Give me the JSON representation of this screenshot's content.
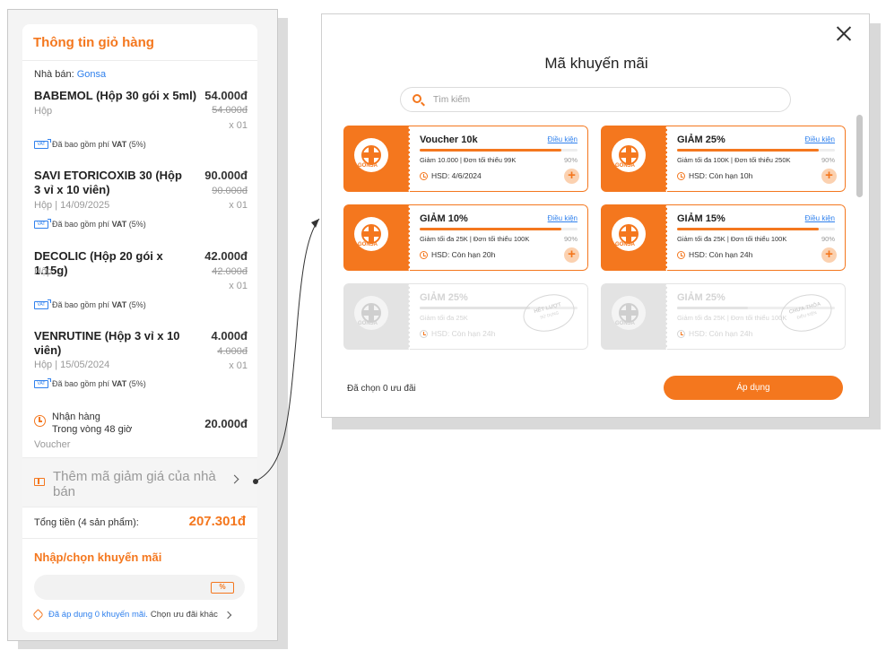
{
  "cart": {
    "title": "Thông tin giỏ hàng",
    "seller_label": "Nhà bán:",
    "seller_name": "Gonsa",
    "items": [
      {
        "name": "BABEMOL (Hộp 30 gói x 5ml)",
        "price": "54.000đ",
        "old_price": "54.000đ",
        "sub": "Hộp",
        "qty": "x 01",
        "vat_prefix": "Đã bao gồm phí",
        "vat_bold": "VAT",
        "vat_suffix": "(5%)"
      },
      {
        "name": "SAVI ETORICOXIB 30 (Hộp 3 vỉ x 10 viên)",
        "price": "90.000đ",
        "old_price": "90.000đ",
        "sub": "Hộp | 14/09/2025",
        "qty": "x 01",
        "vat_prefix": "Đã bao gồm phí",
        "vat_bold": "VAT",
        "vat_suffix": "(5%)"
      },
      {
        "name": "DECOLIC (Hộp 20 gói x 1.15g)",
        "price": "42.000đ",
        "old_price": "42.000đ",
        "sub": "Hộp",
        "qty": "x 01",
        "vat_prefix": "Đã bao gồm phí",
        "vat_bold": "VAT",
        "vat_suffix": "(5%)"
      },
      {
        "name": "VENRUTINE (Hộp 3 vỉ x 10 viên)",
        "price": "4.000đ",
        "old_price": "4.000đ",
        "sub": "Hộp | 15/05/2024",
        "qty": "x 01",
        "vat_prefix": "Đã bao gồm phí",
        "vat_bold": "VAT",
        "vat_suffix": "(5%)"
      }
    ],
    "vat_icon_text": "VAT",
    "delivery": {
      "line1": "Nhận hàng",
      "line2": "Trong vòng 48 giờ",
      "price": "20.000đ",
      "voucher_label": "Voucher"
    },
    "seller_discount": "Thêm mã giảm giá của nhà bán",
    "total_label": "Tổng tiền (4 sản phẩm):",
    "total_value": "207.301đ",
    "promo_title": "Nhập/chọn khuyến mãi",
    "promo_icon_text": "%",
    "applied_text": "Đã áp dụng 0 khuyến mãi.",
    "applied_other": "Chọn ưu đãi khác"
  },
  "modal": {
    "title": "Mã khuyến mãi",
    "search_placeholder": "Tìm kiếm",
    "brand": "GONSA",
    "condition_label": "Điều kiện",
    "vouchers": [
      {
        "title": "Voucher 10k",
        "desc": "Giảm 10.000 | Đơn tối thiểu 99K",
        "percent": "90%",
        "fill": 0.9,
        "expiry": "HSD: 4/6/2024",
        "state": "active"
      },
      {
        "title": "GIẢM 25%",
        "desc": "Giảm tối đa 100K | Đơn tối thiểu 250K",
        "percent": "90%",
        "fill": 0.9,
        "expiry": "HSD: Còn hạn 10h",
        "state": "active"
      },
      {
        "title": "GIẢM 10%",
        "desc": "Giảm tối đa 25K | Đơn tối thiểu 100K",
        "percent": "90%",
        "fill": 0.9,
        "expiry": "HSD: Còn hạn 20h",
        "state": "active"
      },
      {
        "title": "GIẢM 15%",
        "desc": "Giảm tối đa 25K | Đơn tối thiểu 100K",
        "percent": "90%",
        "fill": 0.9,
        "expiry": "HSD: Còn hạn 24h",
        "state": "active"
      },
      {
        "title": "GIẢM 25%",
        "desc": "Giảm tối đa 25K",
        "percent": "",
        "fill": 0.7,
        "expiry": "HSD: Còn hạn 24h",
        "state": "used_up",
        "stamp": "HẾT LƯỢT",
        "stamp_sub": "SỬ DỤNG"
      },
      {
        "title": "GIẢM 25%",
        "desc": "Giảm tối đa 25K | Đơn tối thiểu 100K",
        "percent": "",
        "fill": 0.45,
        "expiry": "HSD: Còn hạn 24h",
        "state": "not_eligible",
        "stamp": "CHƯA THỎA",
        "stamp_sub": "ĐIỀU KIỆN"
      }
    ],
    "chosen_count": "Đã chọn 0 ưu đãi",
    "apply_label": "Áp dụng"
  },
  "colors": {
    "accent": "#f4771e",
    "link": "#2f80ed"
  }
}
